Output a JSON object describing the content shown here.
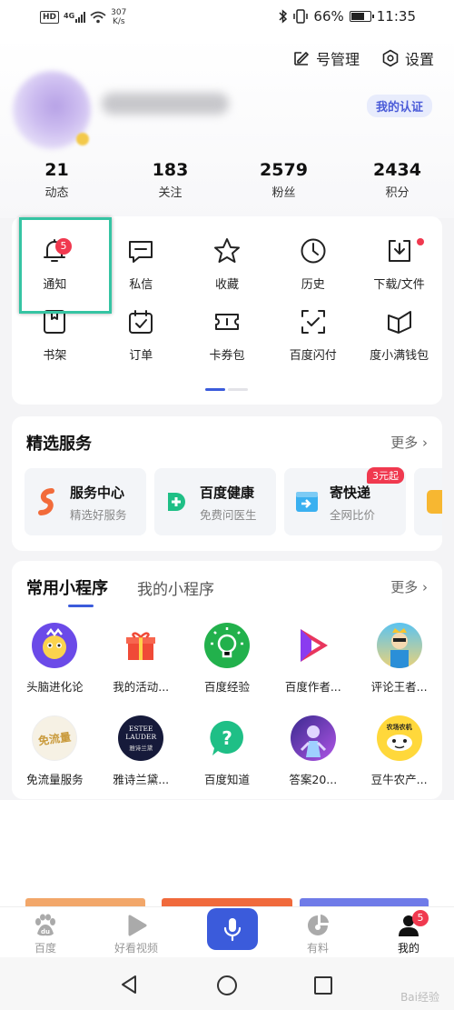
{
  "status_bar": {
    "network": "HD",
    "signal": "4G",
    "speed_value": "307",
    "speed_unit": "K/s",
    "battery": "66%",
    "time": "11:35"
  },
  "header": {
    "account_mgmt_label": "号管理",
    "settings_label": "设置",
    "cert_label": "我的认证",
    "stats": [
      {
        "value": "21",
        "label": "动态"
      },
      {
        "value": "183",
        "label": "关注"
      },
      {
        "value": "2579",
        "label": "粉丝"
      },
      {
        "value": "2434",
        "label": "积分"
      }
    ]
  },
  "tools": {
    "row1": [
      {
        "label": "通知",
        "icon": "bell-icon",
        "badge": "5"
      },
      {
        "label": "私信",
        "icon": "message-icon"
      },
      {
        "label": "收藏",
        "icon": "star-icon"
      },
      {
        "label": "历史",
        "icon": "clock-icon"
      },
      {
        "label": "下载/文件",
        "icon": "download-icon"
      }
    ],
    "row2": [
      {
        "label": "书架",
        "icon": "bookshelf-icon"
      },
      {
        "label": "订单",
        "icon": "order-icon"
      },
      {
        "label": "卡券包",
        "icon": "ticket-icon"
      },
      {
        "label": "百度闪付",
        "icon": "scan-pay-icon"
      },
      {
        "label": "度小满钱包",
        "icon": "wallet-icon"
      }
    ]
  },
  "services": {
    "title": "精选服务",
    "more": "更多",
    "items": [
      {
        "title": "服务中心",
        "subtitle": "精选好服务"
      },
      {
        "title": "百度健康",
        "subtitle": "免费问医生"
      },
      {
        "title": "寄快递",
        "subtitle": "全网比价",
        "tag": "3元起"
      }
    ]
  },
  "mini_programs": {
    "tab_active": "常用小程序",
    "tab_inactive": "我的小程序",
    "more": "更多",
    "items": [
      {
        "label": "头脑进化论"
      },
      {
        "label": "我的活动..."
      },
      {
        "label": "百度经验"
      },
      {
        "label": "百度作者..."
      },
      {
        "label": "评论王者..."
      },
      {
        "label": "免流量服务",
        "icon_text": "免流量"
      },
      {
        "label": "雅诗兰黛...",
        "icon_text": "ESTEE LAUDER",
        "icon_text2": "雅诗兰黛"
      },
      {
        "label": "百度知道"
      },
      {
        "label": "答案20..."
      },
      {
        "label": "豆牛农产...",
        "icon_text": "农场农机"
      }
    ]
  },
  "tabbar": {
    "items": [
      {
        "label": "百度"
      },
      {
        "label": "好看视频"
      },
      {
        "label": ""
      },
      {
        "label": "有料"
      },
      {
        "label": "我的",
        "badge": "5"
      }
    ]
  },
  "watermark": "Bai经验",
  "colors": {
    "accent": "#3b5bdb",
    "badge": "#f0394f",
    "highlight": "#35c4a3"
  }
}
